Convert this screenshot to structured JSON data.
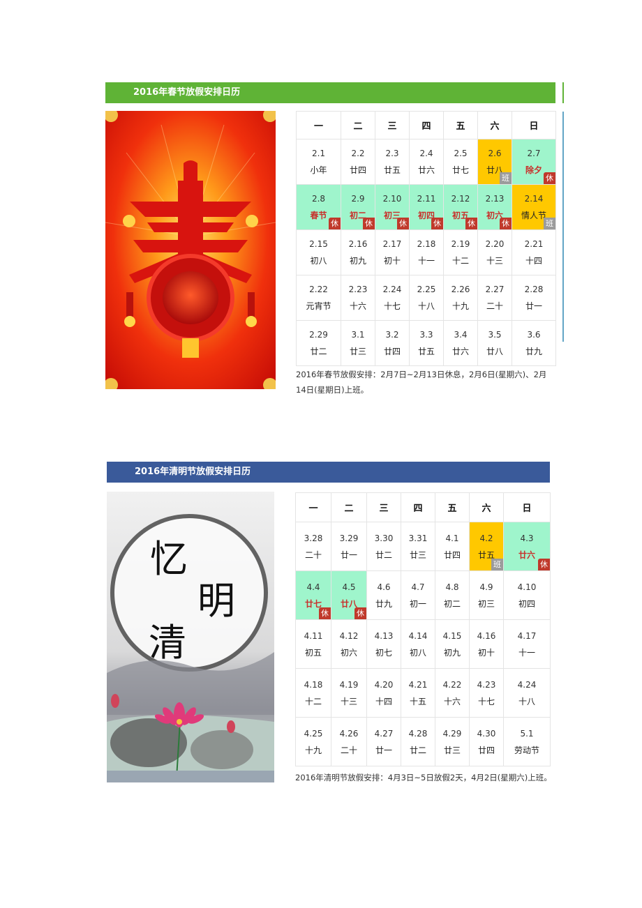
{
  "calendars": [
    {
      "title": "2016年春节放假安排日历",
      "banner_color": "#5fb336",
      "image_label": "春节 decorative poster (red 春 character with lantern)",
      "weekdays": [
        "一",
        "二",
        "三",
        "四",
        "五",
        "六",
        "日"
      ],
      "weeks": [
        [
          {
            "date": "2.1",
            "lunar": "小年"
          },
          {
            "date": "2.2",
            "lunar": "廿四"
          },
          {
            "date": "2.3",
            "lunar": "廿五"
          },
          {
            "date": "2.4",
            "lunar": "廿六"
          },
          {
            "date": "2.5",
            "lunar": "廿七"
          },
          {
            "date": "2.6",
            "lunar": "廿八",
            "status": "work",
            "badge": "班"
          },
          {
            "date": "2.7",
            "lunar": "除夕",
            "status": "off",
            "badge": "休",
            "highlight": true
          }
        ],
        [
          {
            "date": "2.8",
            "lunar": "春节",
            "status": "off",
            "badge": "休",
            "highlight": true
          },
          {
            "date": "2.9",
            "lunar": "初二",
            "status": "off",
            "badge": "休",
            "highlight": true
          },
          {
            "date": "2.10",
            "lunar": "初三",
            "status": "off",
            "badge": "休",
            "highlight": true
          },
          {
            "date": "2.11",
            "lunar": "初四",
            "status": "off",
            "badge": "休",
            "highlight": true
          },
          {
            "date": "2.12",
            "lunar": "初五",
            "status": "off",
            "badge": "休",
            "highlight": true
          },
          {
            "date": "2.13",
            "lunar": "初六",
            "status": "off",
            "badge": "休",
            "highlight": true
          },
          {
            "date": "2.14",
            "lunar": "情人节",
            "status": "work",
            "badge": "班"
          }
        ],
        [
          {
            "date": "2.15",
            "lunar": "初八"
          },
          {
            "date": "2.16",
            "lunar": "初九"
          },
          {
            "date": "2.17",
            "lunar": "初十"
          },
          {
            "date": "2.18",
            "lunar": "十一"
          },
          {
            "date": "2.19",
            "lunar": "十二"
          },
          {
            "date": "2.20",
            "lunar": "十三"
          },
          {
            "date": "2.21",
            "lunar": "十四"
          }
        ],
        [
          {
            "date": "2.22",
            "lunar": "元宵节"
          },
          {
            "date": "2.23",
            "lunar": "十六"
          },
          {
            "date": "2.24",
            "lunar": "十七"
          },
          {
            "date": "2.25",
            "lunar": "十八"
          },
          {
            "date": "2.26",
            "lunar": "十九"
          },
          {
            "date": "2.27",
            "lunar": "二十"
          },
          {
            "date": "2.28",
            "lunar": "廿一"
          }
        ],
        [
          {
            "date": "2.29",
            "lunar": "廿二"
          },
          {
            "date": "3.1",
            "lunar": "廿三"
          },
          {
            "date": "3.2",
            "lunar": "廿四"
          },
          {
            "date": "3.3",
            "lunar": "廿五"
          },
          {
            "date": "3.4",
            "lunar": "廿六"
          },
          {
            "date": "3.5",
            "lunar": "廿八"
          },
          {
            "date": "3.6",
            "lunar": "廿九"
          }
        ]
      ],
      "note": "2016年春节放假安排：2月7日~2月13日休息，2月6日(星期六)、2月14日(星期日)上班。"
    },
    {
      "title": "2016年清明节放假安排日历",
      "banner_color": "#3a5a9a",
      "image_label": "忆清明 ink-wash poster with lotus",
      "weekdays": [
        "一",
        "二",
        "三",
        "四",
        "五",
        "六",
        "日"
      ],
      "weeks": [
        [
          {
            "date": "3.28",
            "lunar": "二十"
          },
          {
            "date": "3.29",
            "lunar": "廿一"
          },
          {
            "date": "3.30",
            "lunar": "廿二"
          },
          {
            "date": "3.31",
            "lunar": "廿三"
          },
          {
            "date": "4.1",
            "lunar": "廿四"
          },
          {
            "date": "4.2",
            "lunar": "廿五",
            "status": "work",
            "badge": "班"
          },
          {
            "date": "4.3",
            "lunar": "廿六",
            "status": "off",
            "badge": "休",
            "highlight": true
          }
        ],
        [
          {
            "date": "4.4",
            "lunar": "廿七",
            "status": "off",
            "badge": "休",
            "highlight": true
          },
          {
            "date": "4.5",
            "lunar": "廿八",
            "status": "off",
            "badge": "休",
            "highlight": true
          },
          {
            "date": "4.6",
            "lunar": "廿九"
          },
          {
            "date": "4.7",
            "lunar": "初一"
          },
          {
            "date": "4.8",
            "lunar": "初二"
          },
          {
            "date": "4.9",
            "lunar": "初三"
          },
          {
            "date": "4.10",
            "lunar": "初四"
          }
        ],
        [
          {
            "date": "4.11",
            "lunar": "初五"
          },
          {
            "date": "4.12",
            "lunar": "初六"
          },
          {
            "date": "4.13",
            "lunar": "初七"
          },
          {
            "date": "4.14",
            "lunar": "初八"
          },
          {
            "date": "4.15",
            "lunar": "初九"
          },
          {
            "date": "4.16",
            "lunar": "初十"
          },
          {
            "date": "4.17",
            "lunar": "十一"
          }
        ],
        [
          {
            "date": "4.18",
            "lunar": "十二"
          },
          {
            "date": "4.19",
            "lunar": "十三"
          },
          {
            "date": "4.20",
            "lunar": "十四"
          },
          {
            "date": "4.21",
            "lunar": "十五"
          },
          {
            "date": "4.22",
            "lunar": "十六"
          },
          {
            "date": "4.23",
            "lunar": "十七"
          },
          {
            "date": "4.24",
            "lunar": "十八"
          }
        ],
        [
          {
            "date": "4.25",
            "lunar": "十九"
          },
          {
            "date": "4.26",
            "lunar": "二十"
          },
          {
            "date": "4.27",
            "lunar": "廿一"
          },
          {
            "date": "4.28",
            "lunar": "廿二"
          },
          {
            "date": "4.29",
            "lunar": "廿三"
          },
          {
            "date": "4.30",
            "lunar": "廿四"
          },
          {
            "date": "5.1",
            "lunar": "劳动节"
          }
        ]
      ],
      "note": "2016年清明节放假安排：4月3日~5日放假2天，4月2日(星期六)上班。"
    }
  ],
  "colors": {
    "off_day_bg": "#9ff5cc",
    "work_day_bg": "#ffc800",
    "off_badge": "#c0392b",
    "work_badge": "#9b9b9b",
    "holiday_text": "#c8302b"
  }
}
